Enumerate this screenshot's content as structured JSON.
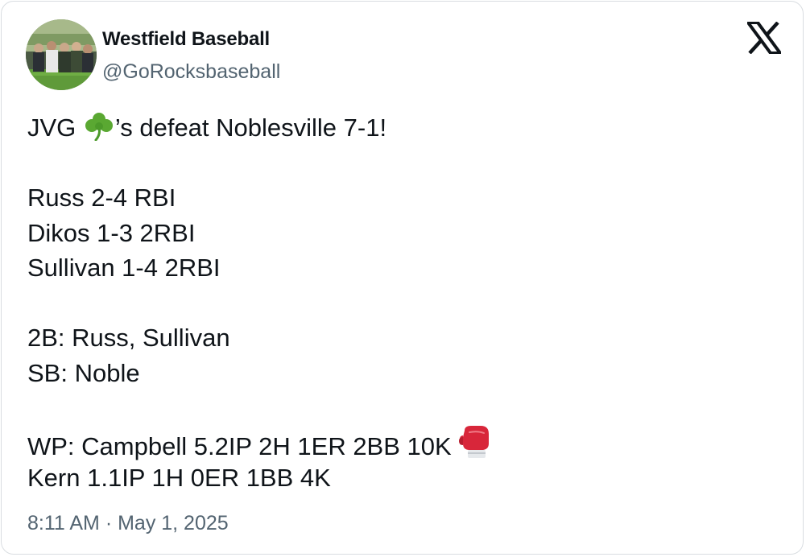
{
  "author": {
    "display_name": "Westfield Baseball",
    "handle": "@GoRocksbaseball",
    "avatar_icon": "team-photo-avatar"
  },
  "platform_icon": "x-logo-icon",
  "tweet": {
    "line1_prefix": "JVG ",
    "line1_emoji": "shamrock-emoji",
    "line1_suffix": "’s defeat Noblesville 7-1!",
    "batting": [
      "Russ 2-4 RBI",
      "Dikos 1-3 2RBI",
      "Sullivan 1-4 2RBI"
    ],
    "extras": [
      "2B: Russ, Sullivan",
      "SB: Noble"
    ],
    "pitching_line1": "WP: Campbell 5.2IP 2H 1ER 2BB 10K ",
    "pitching_line1_emoji": "boxing-glove-emoji",
    "pitching_line2": "Kern 1.1IP 1H 0ER 1BB 4K"
  },
  "timestamp": "8:11 AM · May 1, 2025",
  "colors": {
    "text": "#0f1419",
    "secondary": "#536471",
    "border": "#d9dde1",
    "shamrock": "#5aa832",
    "glove": "#d8263a"
  }
}
